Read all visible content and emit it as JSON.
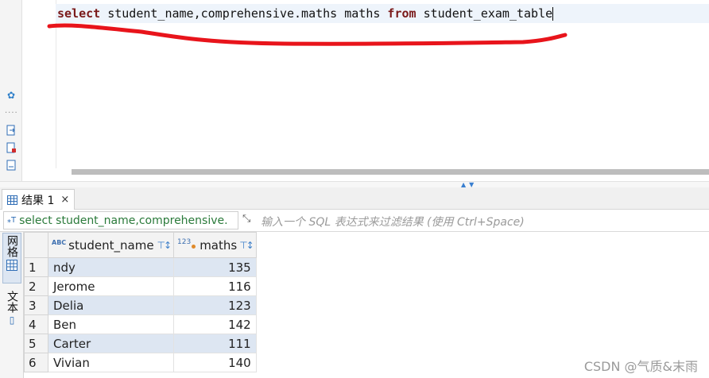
{
  "editor": {
    "sql_parts": {
      "kw1": "select",
      "mid": " student_name,comprehensive.maths maths ",
      "kw2": "from",
      "tail": " student_exam_table"
    }
  },
  "results": {
    "tab_label": "结果 1",
    "tab_close": "×",
    "filter_sql": "select student_name,comprehensive.",
    "filter_placeholder": "输入一个 SQL 表达式来过滤结果 (使用 Ctrl+Space)",
    "side_tabs": {
      "grid": "网格",
      "text": "文本"
    },
    "columns": [
      {
        "type_badge": "ABC",
        "name": "student_name"
      },
      {
        "type_badge": "123",
        "name": "maths"
      }
    ],
    "rows": [
      {
        "n": "1",
        "name": "ndy",
        "maths": "135"
      },
      {
        "n": "2",
        "name": "Jerome",
        "maths": "116"
      },
      {
        "n": "3",
        "name": "Delia",
        "maths": "123"
      },
      {
        "n": "4",
        "name": "Ben",
        "maths": "142"
      },
      {
        "n": "5",
        "name": "Carter",
        "maths": "111"
      },
      {
        "n": "6",
        "name": "Vivian",
        "maths": "140"
      }
    ]
  },
  "watermark": "CSDN @气质&末雨",
  "colors": {
    "keyword": "#7a1a1a",
    "highlight_row": "#dde6f2",
    "annotation_red": "#e8141b",
    "filter_sql_text": "#2a7a3a"
  },
  "icons": [
    "settings-gear-icon",
    "run-script-icon",
    "new-script-icon",
    "export-icon",
    "grid-icon",
    "sort-filter-icon",
    "expand-icon",
    "close-icon"
  ]
}
